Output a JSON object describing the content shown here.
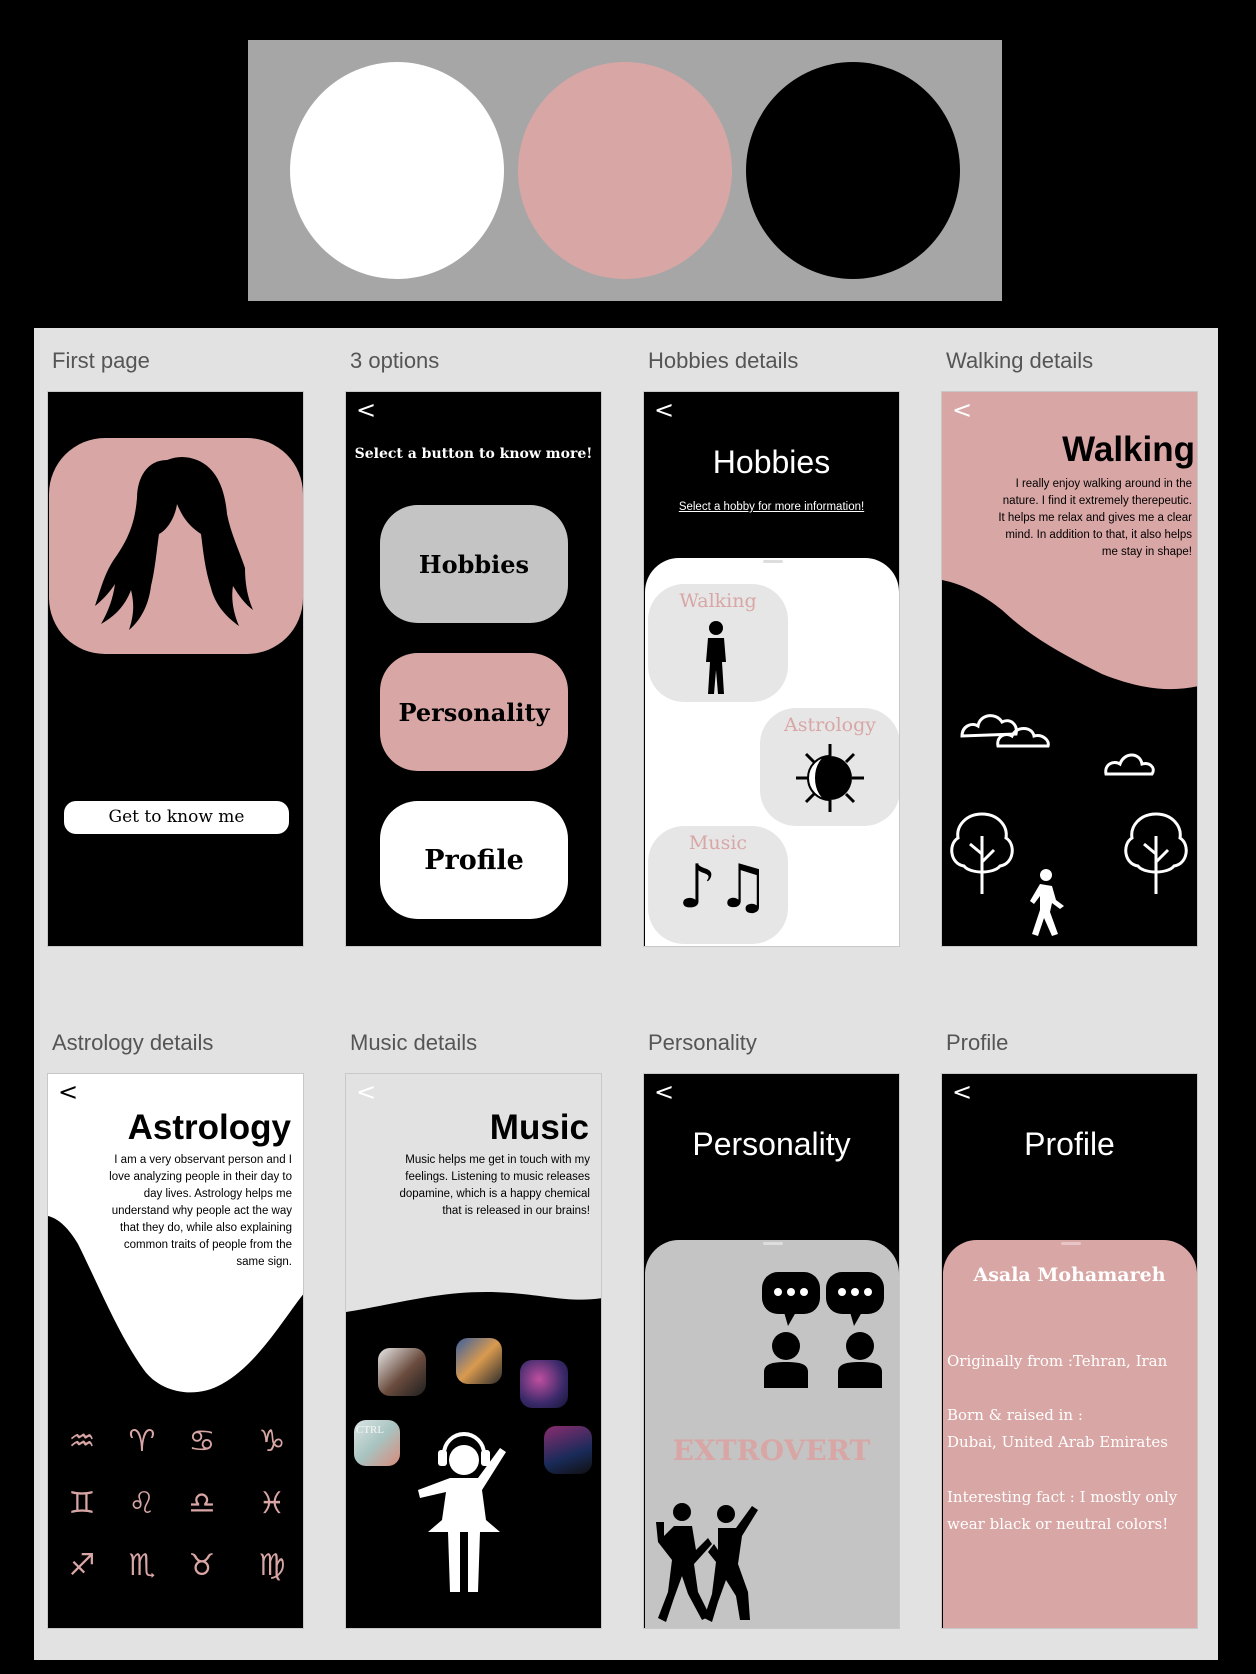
{
  "palette": {
    "colors": [
      "#ffffff",
      "#d8a6a5",
      "#000000"
    ]
  },
  "frames": {
    "first": {
      "label": "First page",
      "button": "Get to know me",
      "hero_icon": "woman-silhouette-icon"
    },
    "options": {
      "label": "3 options",
      "back": "<",
      "heading": "Select a button to know more!",
      "buttons": [
        "Hobbies",
        "Personality",
        "Profile"
      ]
    },
    "hobbies": {
      "label": "Hobbies details",
      "back": "<",
      "title": "Hobbies",
      "subtitle": "Select a hobby for more information!",
      "items": [
        "Walking",
        "Astrology",
        "Music"
      ]
    },
    "walking": {
      "label": "Walking details",
      "back": "<",
      "title": "Walking",
      "text": "I really enjoy walking around in the nature. I find it extremely therepeutic. It helps me relax and gives me a clear mind. In addition to that, it also helps me stay in shape!"
    },
    "astrology": {
      "label": "Astrology details",
      "back": "<",
      "title": "Astrology",
      "text": "I am a very observant person and I love analyzing people in their day to day lives. Astrology helps me understand why people act the way that they do, while also explaining common traits of people from the same sign.",
      "signs": [
        "♒",
        "♈",
        "♋",
        "♑",
        "♊",
        "♌",
        "♎",
        "♓",
        "♐",
        "♏",
        "♉",
        "♍"
      ]
    },
    "music": {
      "label": "Music details",
      "back": "<",
      "title": "Music",
      "text": "Music helps me get in touch with my feelings. Listening to music releases dopamine, which is a happy chemical that is released in our brains!",
      "album_text": "CTRL"
    },
    "personality": {
      "label": "Personality",
      "back": "<",
      "title": "Personality",
      "trait": "EXTROVERT"
    },
    "profile": {
      "label": "Profile",
      "back": "<",
      "title": "Profile",
      "name": "Asala Mohamareh",
      "origin": "Originally from :Tehran, Iran",
      "born_label": "Born & raised in :",
      "born_place": "Dubai, United Arab Emirates",
      "fact": "Interesting fact : I mostly only wear black or neutral colors!"
    }
  }
}
